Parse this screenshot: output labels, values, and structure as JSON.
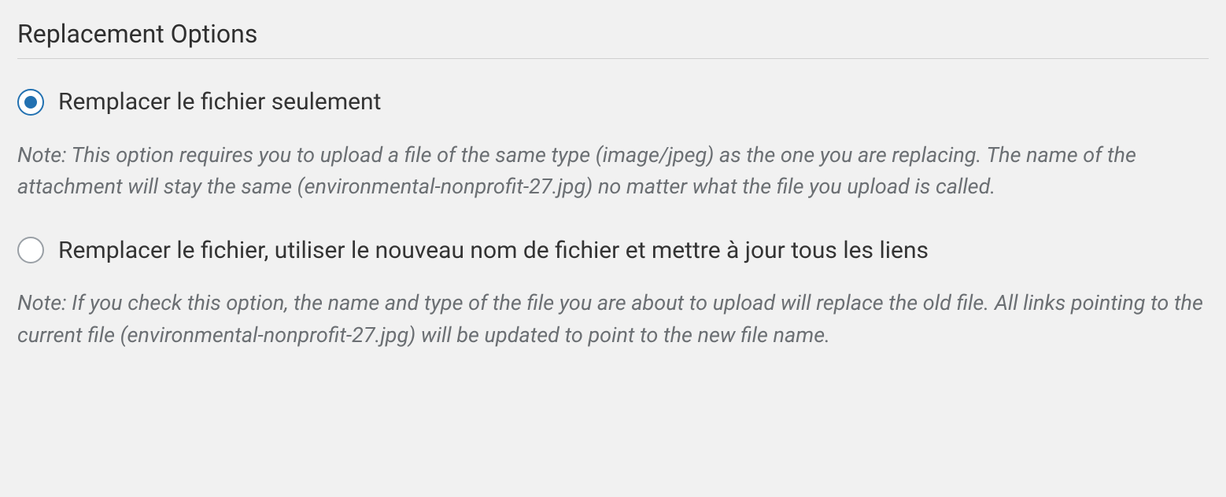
{
  "section": {
    "title": "Replacement Options"
  },
  "options": {
    "replace_file_only": {
      "label": "Remplacer le fichier seulement",
      "note": "Note: This option requires you to upload a file of the same type (image/jpeg) as the one you are replacing. The name of the attachment will stay the same (environmental-nonprofit-27.jpg) no matter what the file you upload is called.",
      "selected": true
    },
    "replace_and_update": {
      "label": "Remplacer le fichier, utiliser le nouveau nom de fichier et mettre à jour tous les liens",
      "note": "Note: If you check this option, the name and type of the file you are about to upload will replace the old file. All links pointing to the current file (environmental-nonprofit-27.jpg) will be updated to point to the new file name.",
      "selected": false
    }
  }
}
